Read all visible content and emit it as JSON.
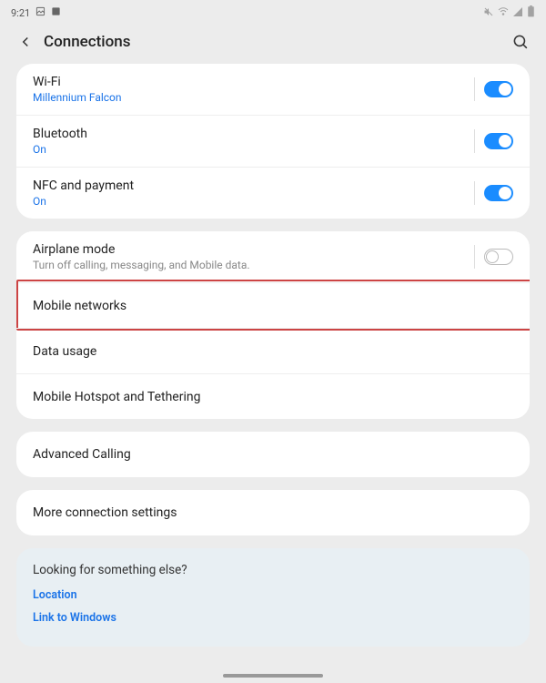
{
  "status": {
    "time": "9:21"
  },
  "header": {
    "title": "Connections"
  },
  "group1": {
    "wifi": {
      "title": "Wi-Fi",
      "sub": "Millennium Falcon"
    },
    "bt": {
      "title": "Bluetooth",
      "sub": "On"
    },
    "nfc": {
      "title": "NFC and payment",
      "sub": "On"
    }
  },
  "group2": {
    "airplane": {
      "title": "Airplane mode",
      "sub": "Turn off calling, messaging, and Mobile data."
    },
    "mobile": {
      "title": "Mobile networks"
    },
    "data": {
      "title": "Data usage"
    },
    "hotspot": {
      "title": "Mobile Hotspot and Tethering"
    }
  },
  "group3": {
    "advcall": {
      "title": "Advanced Calling"
    }
  },
  "group4": {
    "more": {
      "title": "More connection settings"
    }
  },
  "extra": {
    "title": "Looking for something else?",
    "link1": "Location",
    "link2": "Link to Windows"
  }
}
